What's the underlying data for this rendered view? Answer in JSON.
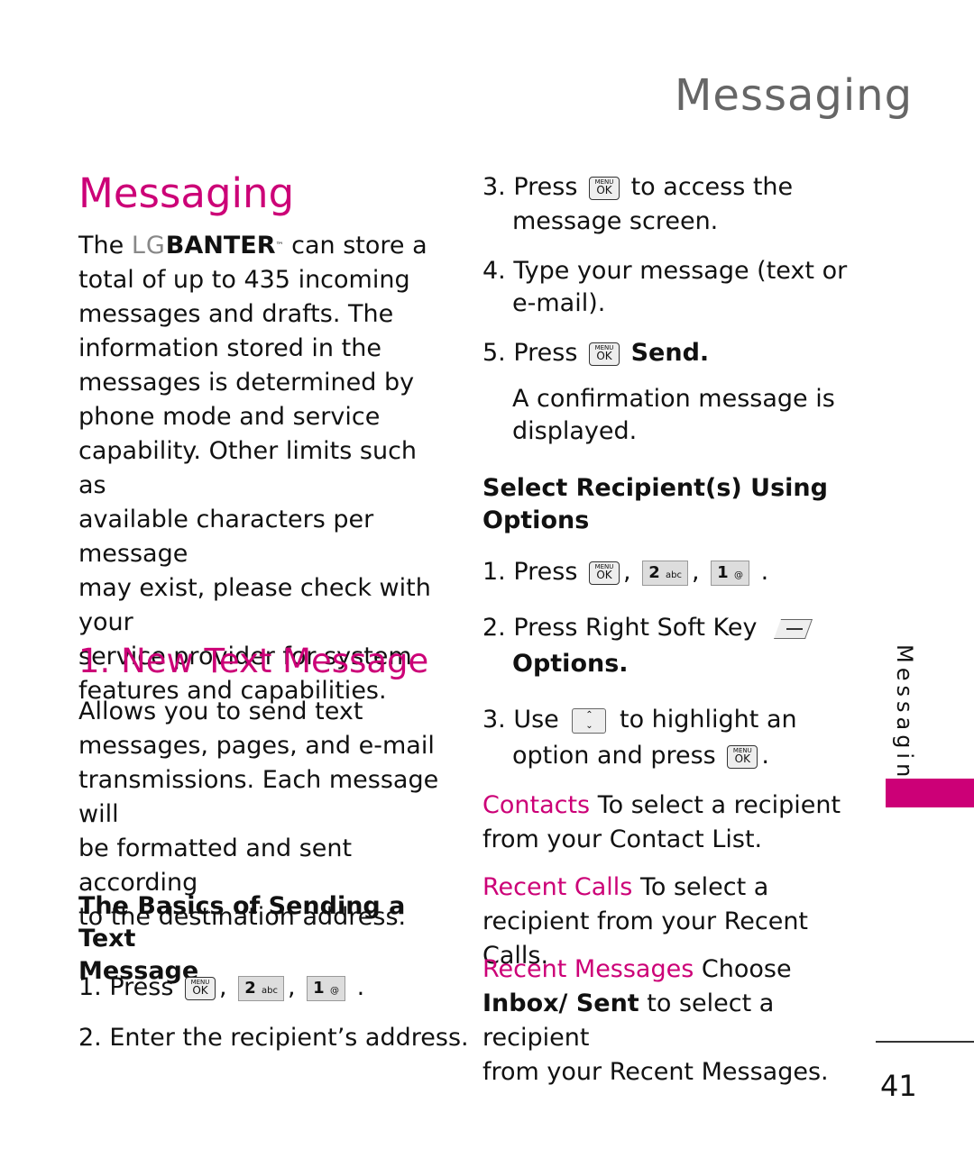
{
  "header": {
    "running_title": "Messaging"
  },
  "side_tab": {
    "label": "Messaging",
    "color": "#cc0077"
  },
  "footer": {
    "page_number": "41"
  },
  "accent_color": "#cc0077",
  "left": {
    "title": "Messaging",
    "intro": {
      "prefix": "The",
      "brand_lg": "LG",
      "brand_name": "BANTER",
      "tm": "™",
      "lines": [
        "can store a",
        "total of up to 435 incoming",
        "messages and drafts. The",
        "information stored in the",
        "messages is determined by",
        "phone mode and service",
        "capability. Other limits such as",
        "available characters per message",
        "may exist, please check with your",
        "service provider for system",
        "features and capabilities."
      ]
    },
    "section_title": "1. New Text Message",
    "section_body": [
      "Allows you to send text",
      "messages, pages, and e-mail",
      "transmissions. Each message will",
      "be formatted and sent according",
      "to the destination address."
    ],
    "subhead": [
      "The Basics of Sending a Text",
      "Message"
    ],
    "steps": {
      "s1_prefix": "1. Press",
      "s1_sep": ",",
      "s1_end": ".",
      "s2": "2. Enter the recipient’s address."
    }
  },
  "keys": {
    "menu_top": "MENU",
    "menu_ok": "OK",
    "key2_num": "2",
    "key2_letters": "abc",
    "key1_num": "1",
    "key1_sub": "@",
    "nav_up": "⌃",
    "nav_down": "⌄"
  },
  "right": {
    "s3_prefix": "3. Press",
    "s3_suffix": "to access the",
    "s3_line2": "message screen.",
    "s4_line1": "4. Type your message (text or",
    "s4_line2": "e-mail).",
    "s5_prefix": "5. Press",
    "s5_action": "Send.",
    "s5_note": [
      "A confirmation message is",
      "displayed."
    ],
    "subhead": [
      "Select Recipient(s) Using",
      "Options"
    ],
    "o1_prefix": "1. Press",
    "o1_sep": ",",
    "o1_end": ".",
    "o2_prefix": "2. Press Right Soft Key",
    "o2_line2": "Options.",
    "o3_prefix": "3. Use",
    "o3_suffix": "to highlight an",
    "o3_line2": "option and press",
    "o3_end": ".",
    "options": [
      {
        "term": "Contacts",
        "text_line1": " To select a recipient",
        "text_line2": "from your Contact List."
      },
      {
        "term": "Recent Calls",
        "text_line1": " To select a",
        "text_line2": "recipient from your Recent Calls."
      },
      {
        "term": "Recent Messages",
        "text_line1": " Choose",
        "bold_line2": "Inbox/ Sent",
        "text_line2": " to select a recipient",
        "text_line3": "from your Recent Messages."
      }
    ]
  }
}
